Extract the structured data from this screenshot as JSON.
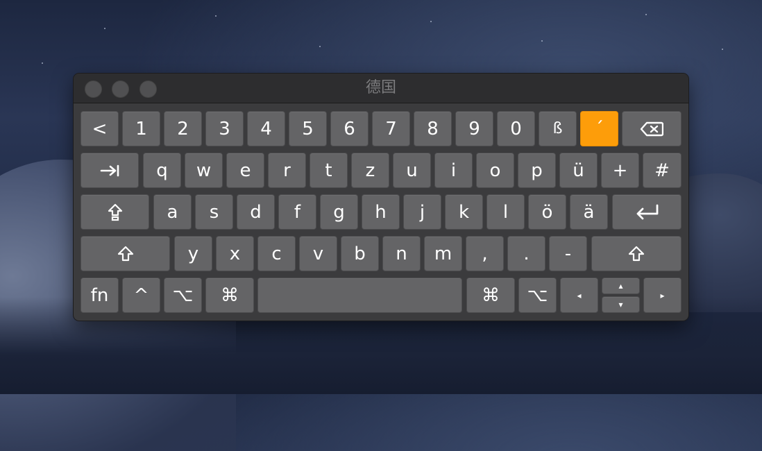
{
  "window": {
    "title": "德国"
  },
  "rows": {
    "row1": [
      "<",
      "1",
      "2",
      "3",
      "4",
      "5",
      "6",
      "7",
      "8",
      "9",
      "0",
      "ß",
      "´"
    ],
    "row2": [
      "q",
      "w",
      "e",
      "r",
      "t",
      "z",
      "u",
      "i",
      "o",
      "p",
      "ü",
      "+",
      "#"
    ],
    "row3": [
      "a",
      "s",
      "d",
      "f",
      "g",
      "h",
      "j",
      "k",
      "l",
      "ö",
      "ä"
    ],
    "row4": [
      "y",
      "x",
      "c",
      "v",
      "b",
      "n",
      "m",
      ",",
      ".",
      "-"
    ],
    "row5": {
      "fn": "fn",
      "control": "^",
      "option_left": "⌥",
      "command_left": "⌘",
      "command_right": "⌘",
      "option_right": "⌥",
      "left": "◂",
      "up": "▴",
      "down": "▾",
      "right": "▸"
    }
  },
  "highlighted_key": "´",
  "colors": {
    "key": "#646466",
    "highlight": "#fd9d0a",
    "window": "#3b3b3d"
  },
  "icons": {
    "backspace": "delete-left-icon",
    "tab": "tab-icon",
    "capslock": "capslock-icon",
    "return": "return-icon",
    "shift": "shift-icon"
  }
}
